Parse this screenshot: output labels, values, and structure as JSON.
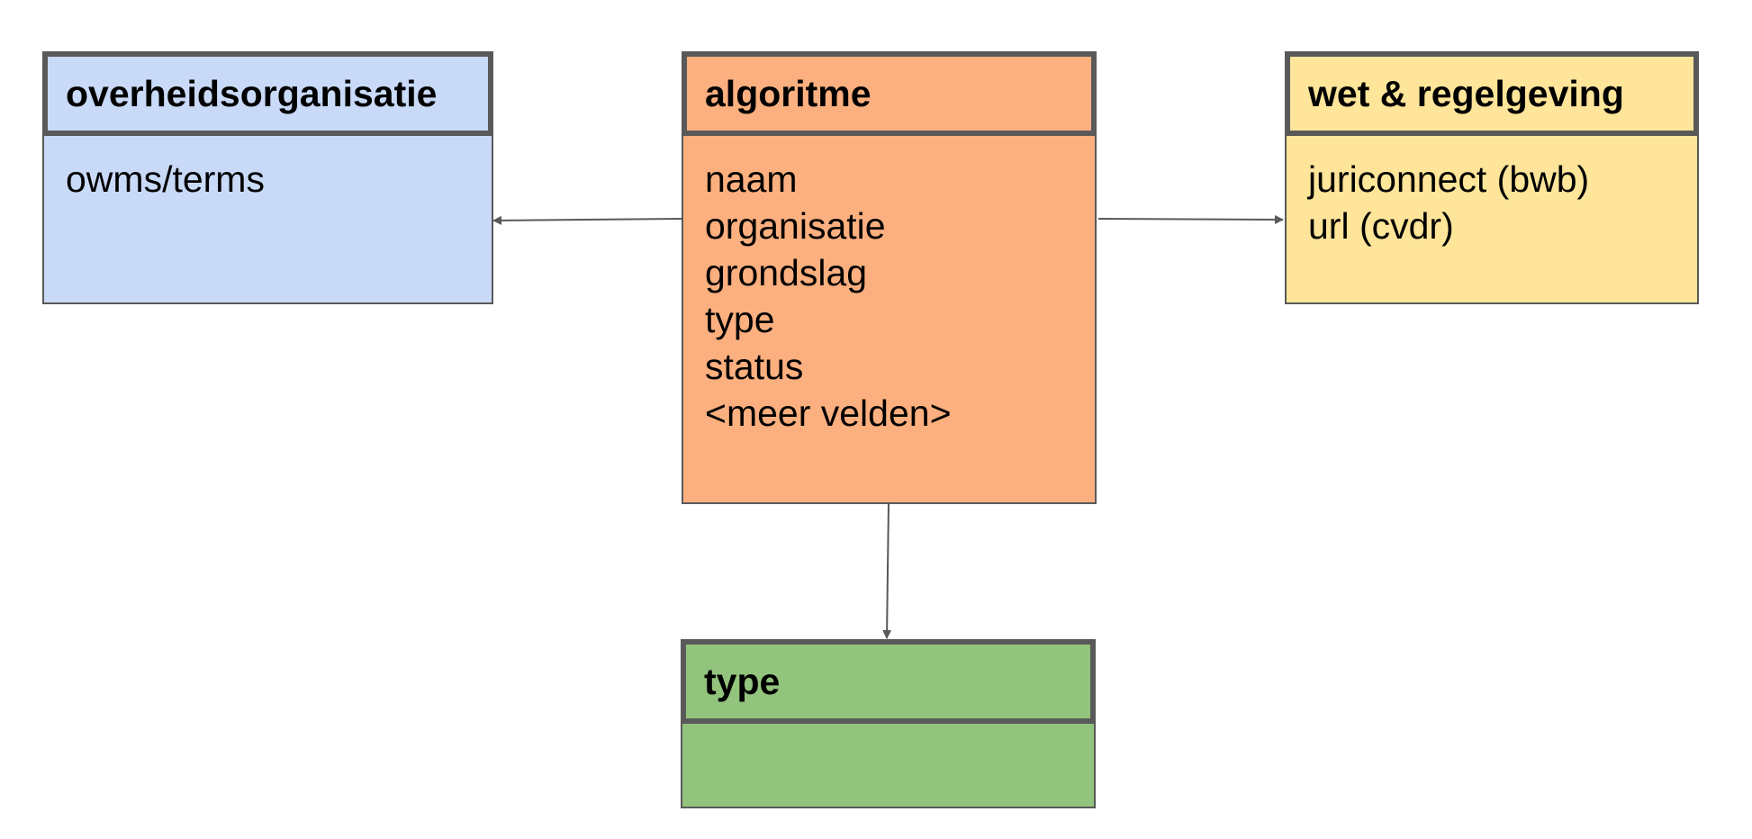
{
  "colors": {
    "organisatie": "#c9daf8",
    "algoritme": "#fdb07f",
    "wet": "#fee599",
    "type": "#93c47d",
    "border": "#595959"
  },
  "entities": {
    "organisatie": {
      "title": "overheidsorganisatie",
      "fields": [
        "owms/terms"
      ]
    },
    "algoritme": {
      "title": "algoritme",
      "fields": [
        "naam",
        "organisatie",
        "grondslag",
        "type",
        "status",
        "<meer velden>"
      ]
    },
    "wet": {
      "title": "wet & regelgeving",
      "fields": [
        "juriconnect (bwb)",
        "url (cvdr)"
      ]
    },
    "type": {
      "title": "type",
      "fields": []
    }
  }
}
